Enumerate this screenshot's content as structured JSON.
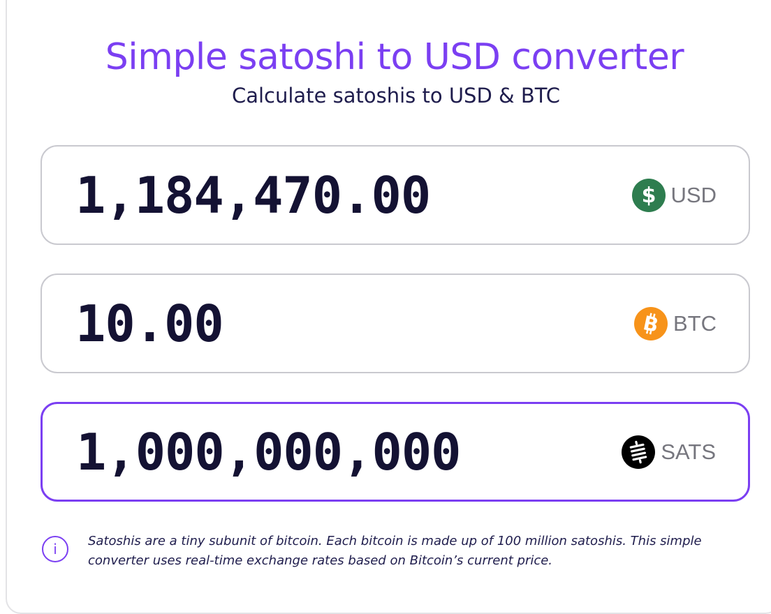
{
  "header": {
    "title": "Simple satoshi to USD converter",
    "subtitle": "Calculate satoshis to USD & BTC"
  },
  "fields": {
    "usd": {
      "value": "1,184,470.00",
      "unit": "USD",
      "icon": "dollar-coin-icon",
      "icon_color": "#2e7d4f"
    },
    "btc": {
      "value": "10.00",
      "unit": "BTC",
      "icon": "bitcoin-coin-icon",
      "icon_color": "#f7931a"
    },
    "sats": {
      "value": "1,000,000,000",
      "unit": "SATS",
      "icon": "sats-coin-icon",
      "icon_color": "#000000",
      "active": true
    }
  },
  "info": {
    "icon_glyph": "i",
    "text": "Satoshis are a tiny subunit of bitcoin. Each bitcoin is made up of 100 million satoshis. This simple converter uses real-time exchange rates based on Bitcoin’s current price."
  },
  "colors": {
    "accent": "#7b3ff2",
    "text_dark": "#141233",
    "unit_gray": "#76767e",
    "border_gray": "#c9c9cf"
  }
}
